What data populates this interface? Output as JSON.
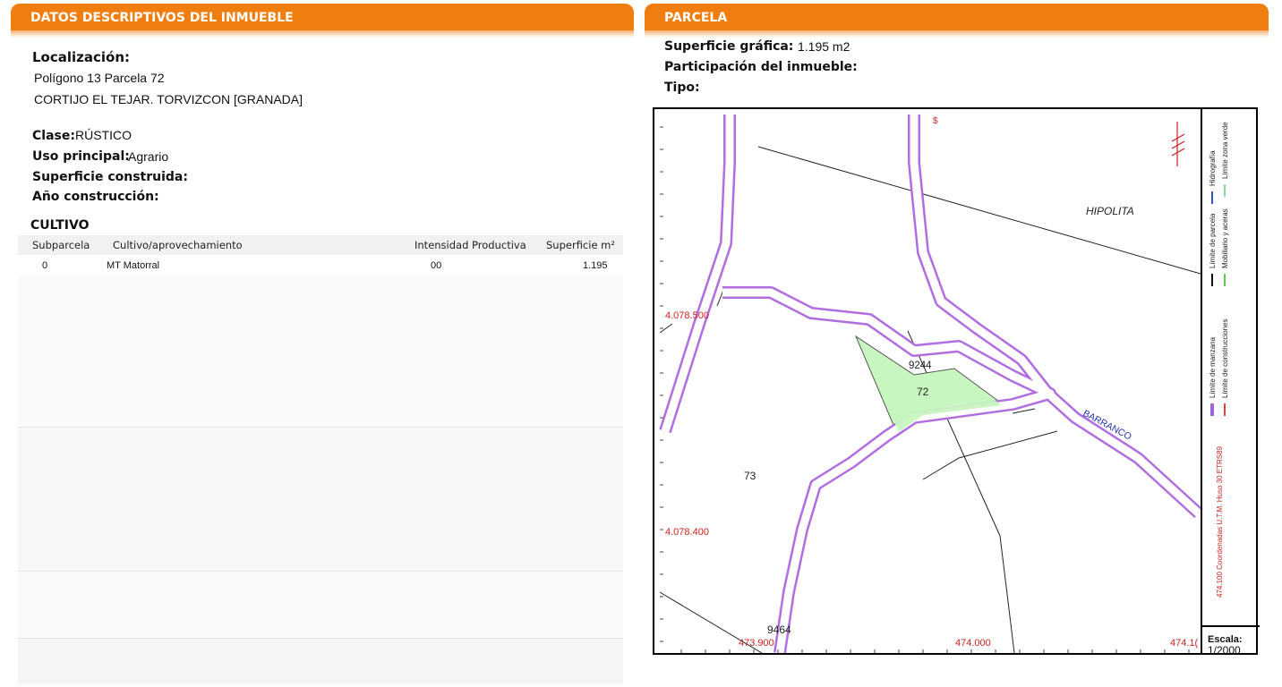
{
  "left_panel": {
    "header": "DATOS DESCRIPTIVOS DEL INMUEBLE",
    "localizacion_label": "Localización:",
    "localizacion_line1": "Polígono 13 Parcela 72",
    "localizacion_line2": "CORTIJO EL TEJAR. TORVIZCON [GRANADA]",
    "clase_label": "Clase:",
    "clase_value": "RÚSTICO",
    "uso_label": "Uso principal:",
    "uso_value": "Agrario",
    "superficie_construida_label": "Superficie construida:",
    "ano_construccion_label": "Año construcción:",
    "cultivo_title": "CULTIVO",
    "table": {
      "headers": [
        "Subparcela",
        "Cultivo/aprovechamiento",
        "Intensidad Productiva",
        "Superficie m²"
      ],
      "rows": [
        {
          "subparcela": "0",
          "cultivo": "MT Matorral",
          "intensidad": "00",
          "superficie": "1.195"
        }
      ]
    }
  },
  "right_panel": {
    "header": "PARCELA",
    "superficie_grafica_label": "Superficie gráfica:",
    "superficie_grafica_value": "1.195 m2",
    "participacion_label": "Participación del inmueble:",
    "tipo_label": "Tipo:"
  },
  "map": {
    "labels": {
      "hipolita": "HIPOLITA",
      "barranco": "BARRANCO",
      "parcel_72": "72",
      "parcel_73": "73",
      "parcel_9244": "9244",
      "parcel_9464": "9464"
    },
    "coords": {
      "y_4078500": "4.078.500",
      "y_4078400": "4.078.400",
      "x_473900": "473.900",
      "x_474000": "474.000",
      "x_4741": "474.1("
    },
    "colors": {
      "parcel_fill": "#c8f5c0",
      "outline_purple": "#b06ee0",
      "coord_red": "#cc2222",
      "header_orange": "#f07d0f"
    },
    "legend": {
      "items": [
        "Límite de manzana",
        "Límite de construcciones",
        "Límite de parcela",
        "Mobiliario y aceras",
        "Hidrografía",
        "Límite zona verde"
      ],
      "crs_note": "474.100 Coordenadas U.T.M. Huso 30 ETRS89",
      "scale_label": "Escala:",
      "scale_value": "1/2000"
    }
  }
}
